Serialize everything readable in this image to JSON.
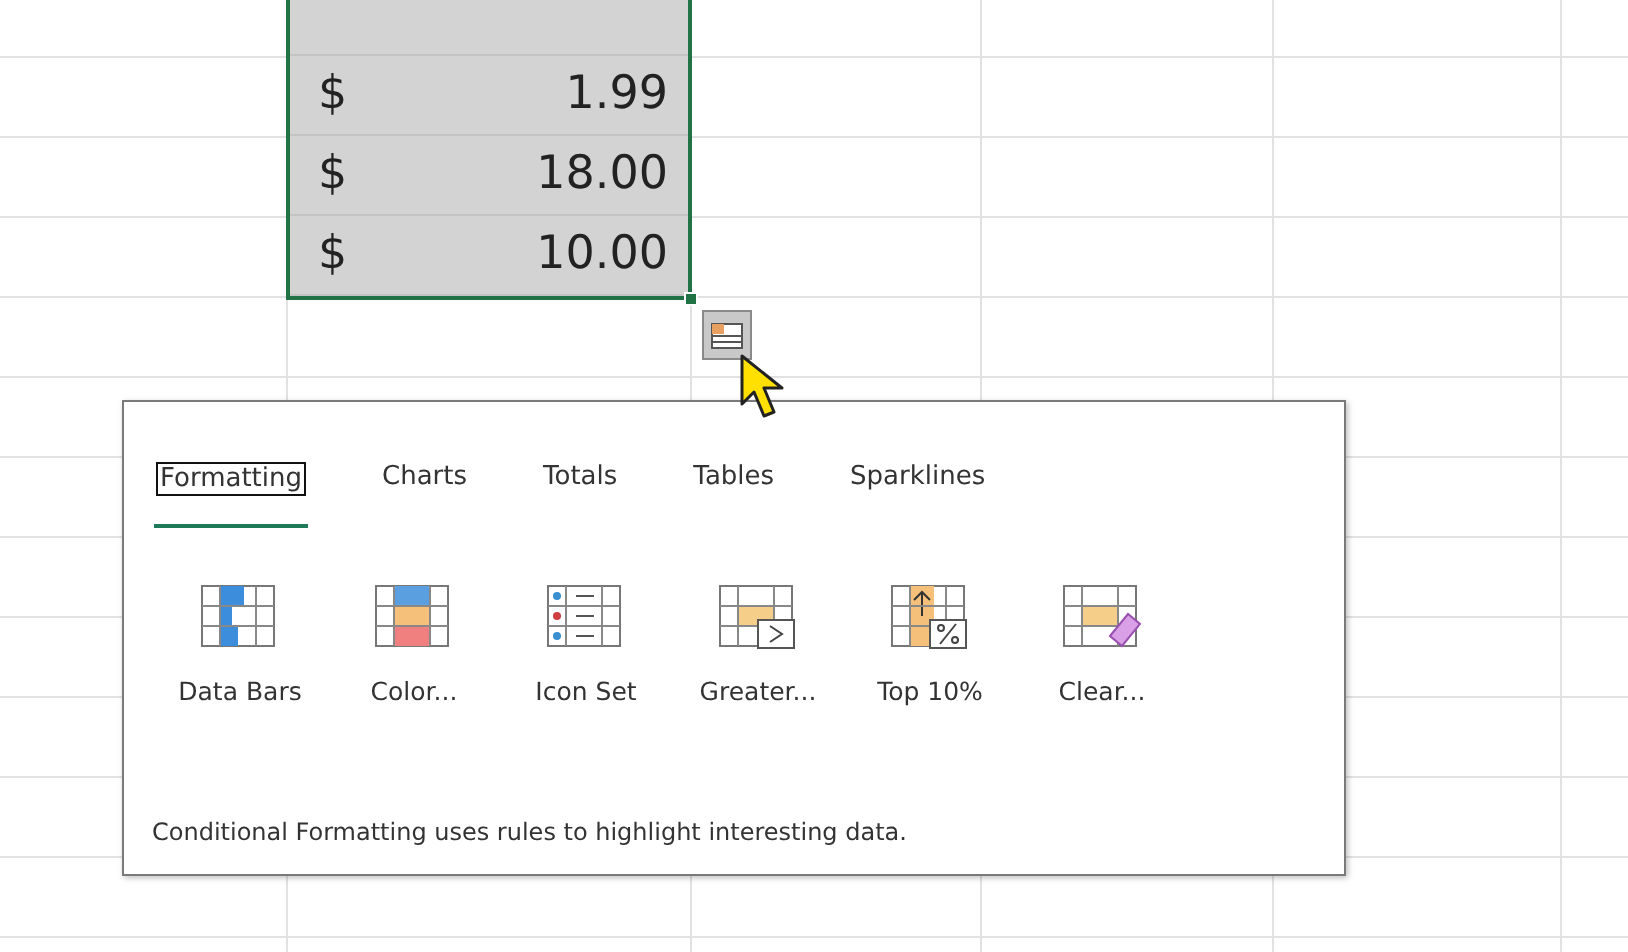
{
  "selection": {
    "cells": [
      {
        "symbol": "$",
        "value": "1.99"
      },
      {
        "symbol": "$",
        "value": "18.00"
      },
      {
        "symbol": "$",
        "value": "10.00"
      }
    ]
  },
  "quick_analysis": {
    "tabs": [
      {
        "label": "Formatting",
        "selected": true
      },
      {
        "label": "Charts",
        "selected": false
      },
      {
        "label": "Totals",
        "selected": false
      },
      {
        "label": "Tables",
        "selected": false
      },
      {
        "label": "Sparklines",
        "selected": false
      }
    ],
    "options": [
      {
        "label": "Data Bars",
        "kind": "databars"
      },
      {
        "label": "Color...",
        "kind": "colorscale"
      },
      {
        "label": "Icon Set",
        "kind": "iconset"
      },
      {
        "label": "Greater...",
        "kind": "greater"
      },
      {
        "label": "Top 10%",
        "kind": "top"
      },
      {
        "label": "Clear...",
        "kind": "clear"
      }
    ],
    "description": "Conditional Formatting uses rules to highlight interesting data."
  }
}
